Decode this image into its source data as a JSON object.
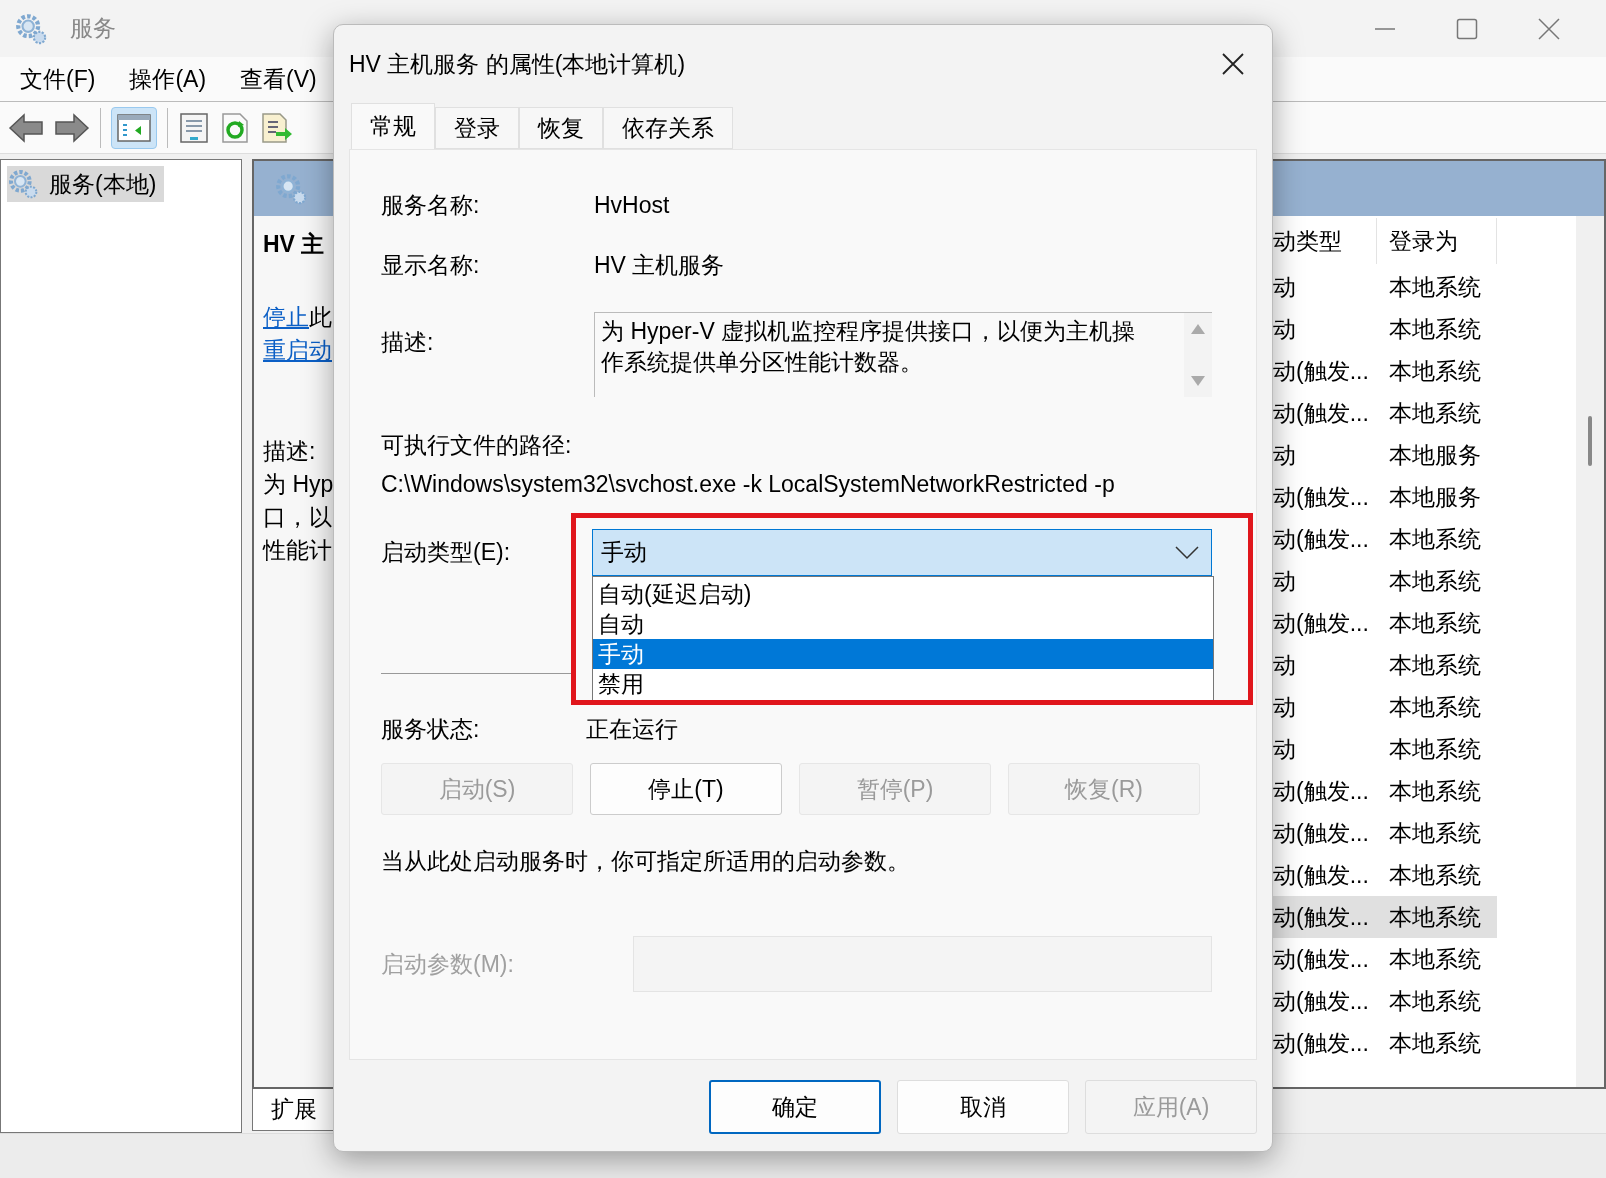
{
  "window": {
    "title": "服务",
    "menu": [
      "文件(F)",
      "操作(A)",
      "查看(V)"
    ]
  },
  "tree": {
    "items": [
      {
        "label": "服务(本地)",
        "selected": true
      }
    ]
  },
  "detail": {
    "title": "HV 主",
    "stop_link": "停止",
    "stop_rest": "此",
    "restart_link": "重启动",
    "description_label": "描述:",
    "description_lines": [
      "为 Hyp",
      "口，以",
      "性能计"
    ]
  },
  "list": {
    "columns": [
      "动类型",
      "登录为"
    ],
    "rows": [
      {
        "startup": "动",
        "logon": "本地系统",
        "selected": false
      },
      {
        "startup": "动",
        "logon": "本地系统",
        "selected": false
      },
      {
        "startup": "动(触发...",
        "logon": "本地系统",
        "selected": false
      },
      {
        "startup": "动(触发...",
        "logon": "本地系统",
        "selected": false
      },
      {
        "startup": "动",
        "logon": "本地服务",
        "selected": false
      },
      {
        "startup": "动(触发...",
        "logon": "本地服务",
        "selected": false
      },
      {
        "startup": "动(触发...",
        "logon": "本地系统",
        "selected": false
      },
      {
        "startup": "动",
        "logon": "本地系统",
        "selected": false
      },
      {
        "startup": "动(触发...",
        "logon": "本地系统",
        "selected": false
      },
      {
        "startup": "动",
        "logon": "本地系统",
        "selected": false
      },
      {
        "startup": "动",
        "logon": "本地系统",
        "selected": false
      },
      {
        "startup": "动",
        "logon": "本地系统",
        "selected": false
      },
      {
        "startup": "动(触发...",
        "logon": "本地系统",
        "selected": false
      },
      {
        "startup": "动(触发...",
        "logon": "本地系统",
        "selected": false
      },
      {
        "startup": "动(触发...",
        "logon": "本地系统",
        "selected": false
      },
      {
        "startup": "动(触发...",
        "logon": "本地系统",
        "selected": true
      },
      {
        "startup": "动(触发...",
        "logon": "本地系统",
        "selected": false
      },
      {
        "startup": "动(触发...",
        "logon": "本地系统",
        "selected": false
      },
      {
        "startup": "动(触发...",
        "logon": "本地系统",
        "selected": false
      }
    ]
  },
  "bottom_tabs": [
    {
      "label": "扩展",
      "selected": true
    }
  ],
  "dialog": {
    "title": "HV 主机服务 的属性(本地计算机)",
    "tabs": [
      {
        "label": "常规",
        "selected": true
      },
      {
        "label": "登录",
        "selected": false
      },
      {
        "label": "恢复",
        "selected": false
      },
      {
        "label": "依存关系",
        "selected": false
      }
    ],
    "service_name_label": "服务名称:",
    "service_name": "HvHost",
    "display_name_label": "显示名称:",
    "display_name": "HV 主机服务",
    "description_label": "描述:",
    "description": "为 Hyper-V 虚拟机监控程序提供接口，以便为主机操作系统提供单分区性能计数器。",
    "path_label": "可执行文件的路径:",
    "path": "C:\\Windows\\system32\\svchost.exe -k LocalSystemNetworkRestricted -p",
    "startup_type": {
      "label": "启动类型(E):",
      "value": "手动",
      "expanded": true,
      "options": [
        {
          "label": "自动(延迟启动)",
          "selected": false
        },
        {
          "label": "自动",
          "selected": false
        },
        {
          "label": "手动",
          "selected": true
        },
        {
          "label": "禁用",
          "selected": false
        }
      ]
    },
    "status_label": "服务状态:",
    "status": "正在运行",
    "buttons": [
      {
        "label": "启动(S)",
        "disabled": true
      },
      {
        "label": "停止(T)",
        "disabled": false
      },
      {
        "label": "暂停(P)",
        "disabled": true
      },
      {
        "label": "恢复(R)",
        "disabled": true
      }
    ],
    "hint": "当从此处启动服务时，你可指定所适用的启动参数。",
    "params": {
      "label": "启动参数(M):",
      "disabled": true
    },
    "footer_buttons": [
      {
        "label": "确定",
        "default": true,
        "disabled": false
      },
      {
        "label": "取消",
        "default": false,
        "disabled": false
      },
      {
        "label": "应用(A)",
        "default": false,
        "disabled": true
      }
    ]
  }
}
